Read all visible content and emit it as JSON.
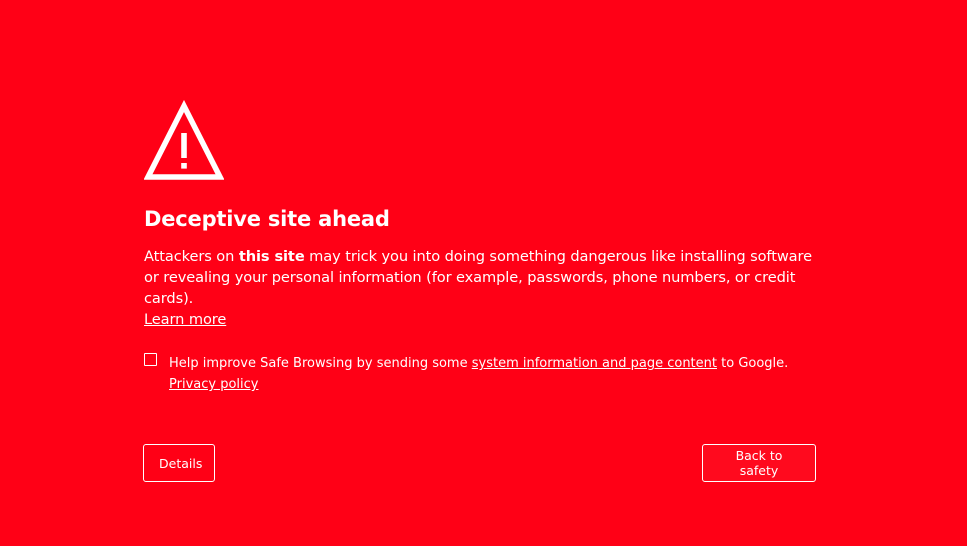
{
  "interstitial": {
    "icon": "warning-triangle-icon",
    "heading": "Deceptive site ahead",
    "message": {
      "prefix": "Attackers on ",
      "emphasis": "this site",
      "suffix": " may trick you into doing something dangerous like installing software or revealing your personal information (for example, passwords, phone numbers, or credit cards).",
      "learn_more": "Learn more"
    },
    "optin": {
      "checked": false,
      "text_before": "Help improve Safe Browsing by sending some ",
      "link": "system information and page content",
      "text_after": " to Google.",
      "privacy_link": "Privacy policy"
    },
    "buttons": {
      "details": "Details",
      "back_to_safety": "Back to safety"
    }
  },
  "colors": {
    "background": "#ff0016",
    "text": "#ffffff"
  }
}
